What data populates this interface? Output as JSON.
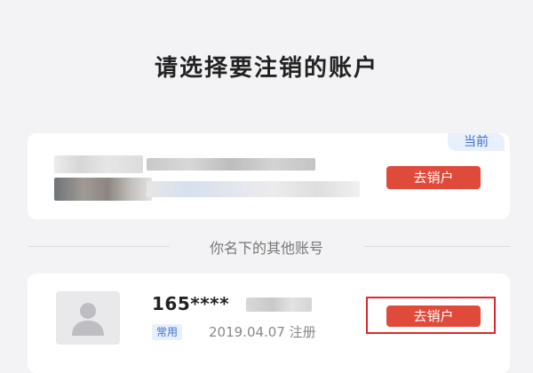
{
  "page": {
    "title": "请选择要注销的账户"
  },
  "current_account": {
    "tag": "当前",
    "action_label": "去销户"
  },
  "divider": {
    "label": "你名下的其他账号"
  },
  "other_accounts": [
    {
      "phone": "165****",
      "tag": "常用",
      "registered": "2019.04.07 注册",
      "action_label": "去销户"
    }
  ],
  "colors": {
    "accent_red": "#e04a3b",
    "tag_blue": "#3b6fd0",
    "highlight_red": "#e0282a"
  }
}
